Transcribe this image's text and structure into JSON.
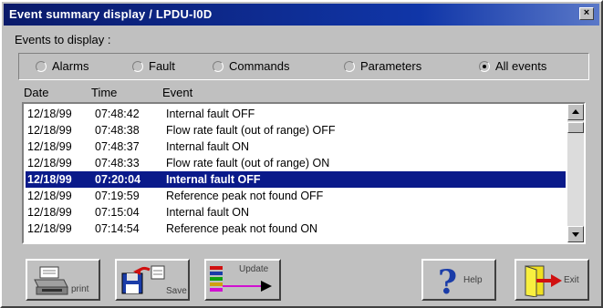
{
  "window": {
    "title": "Event summary display / LPDU-I0D",
    "close_glyph": "×"
  },
  "filter": {
    "label": "Events to display :",
    "options": [
      {
        "label": "Alarms",
        "selected": false
      },
      {
        "label": "Fault",
        "selected": false
      },
      {
        "label": "Commands",
        "selected": false
      },
      {
        "label": "Parameters",
        "selected": false
      },
      {
        "label": "All events",
        "selected": true
      }
    ]
  },
  "table": {
    "headers": [
      "Date",
      "Time",
      "Event"
    ],
    "rows": [
      {
        "date": "12/18/99",
        "time": "07:48:42",
        "event": "Internal fault OFF"
      },
      {
        "date": "12/18/99",
        "time": "07:48:38",
        "event": "Flow rate fault (out of range) OFF"
      },
      {
        "date": "12/18/99",
        "time": "07:48:37",
        "event": "Internal fault ON"
      },
      {
        "date": "12/18/99",
        "time": "07:48:33",
        "event": "Flow rate fault (out of range) ON"
      },
      {
        "date": "12/18/99",
        "time": "07:20:04",
        "event": "Internal fault OFF"
      },
      {
        "date": "12/18/99",
        "time": "07:19:59",
        "event": "Reference peak not found OFF"
      },
      {
        "date": "12/18/99",
        "time": "07:15:04",
        "event": "Internal fault ON"
      },
      {
        "date": "12/18/99",
        "time": "07:14:54",
        "event": "Reference peak not found ON"
      }
    ],
    "selected_row": 4
  },
  "buttons": {
    "print": "print",
    "save": "Save",
    "update": "Update",
    "help": "Help",
    "exit": "Exit"
  },
  "colors": {
    "selection": "#0a1a8a",
    "title_bar": "#1036a8"
  }
}
